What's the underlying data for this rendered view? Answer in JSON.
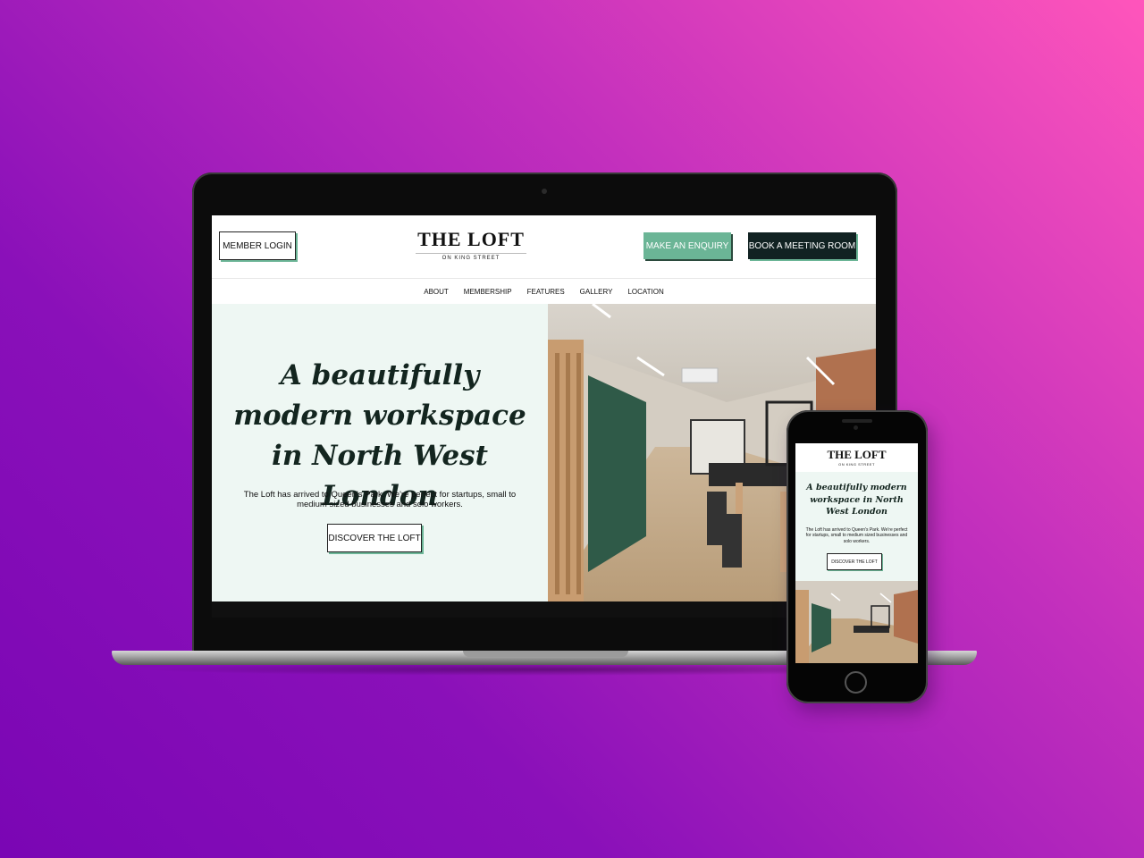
{
  "site": {
    "logo_title": "THE LOFT",
    "logo_subtitle": "ON KING STREET",
    "member_login": "MEMBER LOGIN",
    "make_enquiry": "MAKE AN ENQUIRY",
    "book_meeting": "BOOK A MEETING ROOM",
    "nav": [
      "ABOUT",
      "MEMBERSHIP",
      "FEATURES",
      "GALLERY",
      "LOCATION"
    ],
    "hero_title": "A beautifully modern workspace in North West London",
    "hero_text": "The Loft has arrived to Queen's Park. We're perfect for startups, small to medium sized businesses and solo workers.",
    "discover_button": "DISCOVER THE LOFT"
  },
  "colors": {
    "accent_green": "#6bb596",
    "dark_button": "#112222",
    "hero_bg": "#eef7f3",
    "background_gradient_start": "#ff55bb",
    "background_gradient_end": "#7a06b4"
  }
}
